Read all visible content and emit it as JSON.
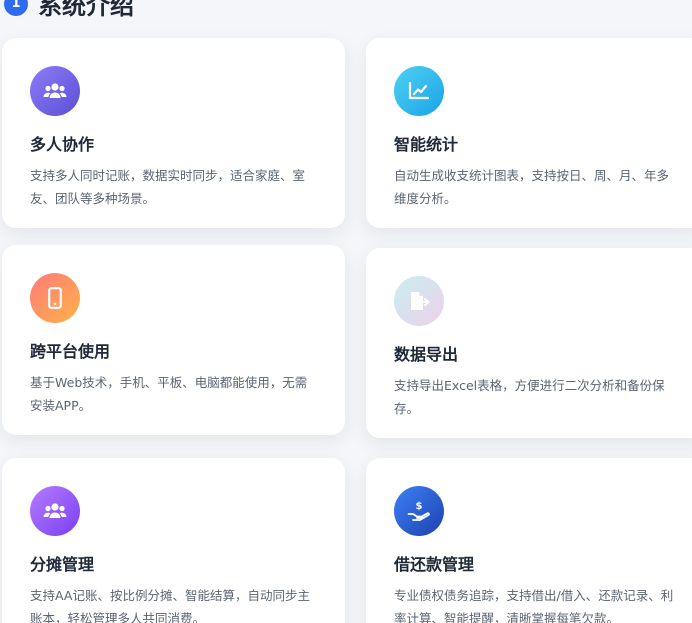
{
  "section": {
    "badge": "1",
    "title": "系统介绍"
  },
  "features": [
    {
      "icon": "users-icon",
      "title": "多人协作",
      "desc": "支持多人同时记账，数据实时同步，适合家庭、室友、团队等多种场景。"
    },
    {
      "icon": "chart-line-icon",
      "title": "智能统计",
      "desc": "自动生成收支统计图表，支持按日、周、月、年多维度分析。"
    },
    {
      "icon": "mobile-icon",
      "title": "跨平台使用",
      "desc": "基于Web技术，手机、平板、电脑都能使用，无需安装APP。"
    },
    {
      "icon": "file-export-icon",
      "title": "数据导出",
      "desc": "支持导出Excel表格，方便进行二次分析和备份保存。"
    },
    {
      "icon": "users-split-icon",
      "title": "分摊管理",
      "desc": "支持AA记账、按比例分摊、智能结算，自动同步主账本，轻松管理多人共同消费。"
    },
    {
      "icon": "hand-dollar-icon",
      "title": "借还款管理",
      "desc": "专业债权债务追踪，支持借出/借入、还款记录、利率计算、智能提醒，清晰掌握每笔欠款。"
    }
  ]
}
